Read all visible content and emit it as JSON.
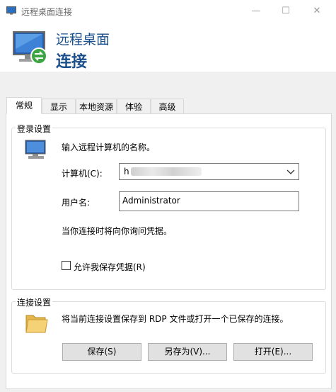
{
  "window": {
    "title": "远程桌面连接",
    "minimize_glyph": "—",
    "maximize_glyph": "☐",
    "close_glyph": "✕"
  },
  "header": {
    "line1": "远程桌面",
    "line2": "连接"
  },
  "tabs": [
    {
      "label": "常规",
      "active": true
    },
    {
      "label": "显示",
      "active": false
    },
    {
      "label": "本地资源",
      "active": false
    },
    {
      "label": "体验",
      "active": false
    },
    {
      "label": "高级",
      "active": false
    }
  ],
  "login_settings": {
    "group_label": "登录设置",
    "instruction": "输入远程计算机的名称。",
    "computer_label": "计算机(C):",
    "computer_value": "h",
    "username_label": "用户名:",
    "username_value": "Administrator",
    "prompt_note": "当你连接时将向你询问凭据。",
    "save_credentials_label": "允许我保存凭据(R)",
    "save_credentials_checked": false
  },
  "connection_settings": {
    "group_label": "连接设置",
    "description": "将当前连接设置保存到 RDP 文件或打开一个已保存的连接。",
    "save_button": "保存(S)",
    "save_as_button": "另存为(V)...",
    "open_button": "打开(E)..."
  },
  "icons": {
    "app": "remote-desktop-icon",
    "header": "remote-desktop-monitor-icon",
    "login": "computer-icon",
    "connection": "folder-icon",
    "dropdown": "chevron-down-icon"
  }
}
